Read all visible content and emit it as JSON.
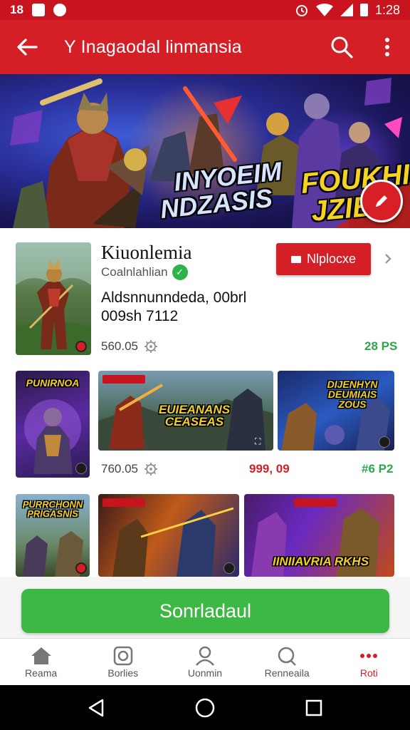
{
  "status_bar": {
    "time": "1:28",
    "left_text": "18"
  },
  "app_bar": {
    "title": "Y Inagaodal linmansia"
  },
  "banner": {
    "text_left": "INYOEIM\nNDZASIS",
    "text_right": "FOUKHIN\nJZIBN"
  },
  "featured": {
    "title": "Kiuonlemia",
    "developer": "Coalnlahlian",
    "description_line1": "Aldsnnunndeda, 00brl",
    "description_line2": "009sh 7112",
    "install_label": "Nlplocxe",
    "downloads": "560.05",
    "rating": "28 PS"
  },
  "grid_row1": {
    "card1_label": "PUNIRNOA",
    "card2_label": "EUIEANANS\nCEASEAS",
    "card3_label": "DIJENHYN\nDEUMIAIS\nZOUS",
    "downloads": "760.05",
    "price": "999, 09",
    "rating": "#6 P2"
  },
  "grid_row2": {
    "card1_label": "PURRCHONN\nPRIGASNIS",
    "card3_label": "IINIIAVRIA RKHS"
  },
  "primary_button": {
    "label": "Sonrladaul"
  },
  "bottom_nav": {
    "items": [
      {
        "label": "Reama",
        "icon": "home-icon"
      },
      {
        "label": "Borlies",
        "icon": "games-icon"
      },
      {
        "label": "Uonmin",
        "icon": "profile-icon"
      },
      {
        "label": "Renneaila",
        "icon": "search-icon"
      },
      {
        "label": "Roti",
        "icon": "more-icon"
      }
    ]
  },
  "colors": {
    "brand_red": "#d51f26",
    "green": "#3db844"
  }
}
